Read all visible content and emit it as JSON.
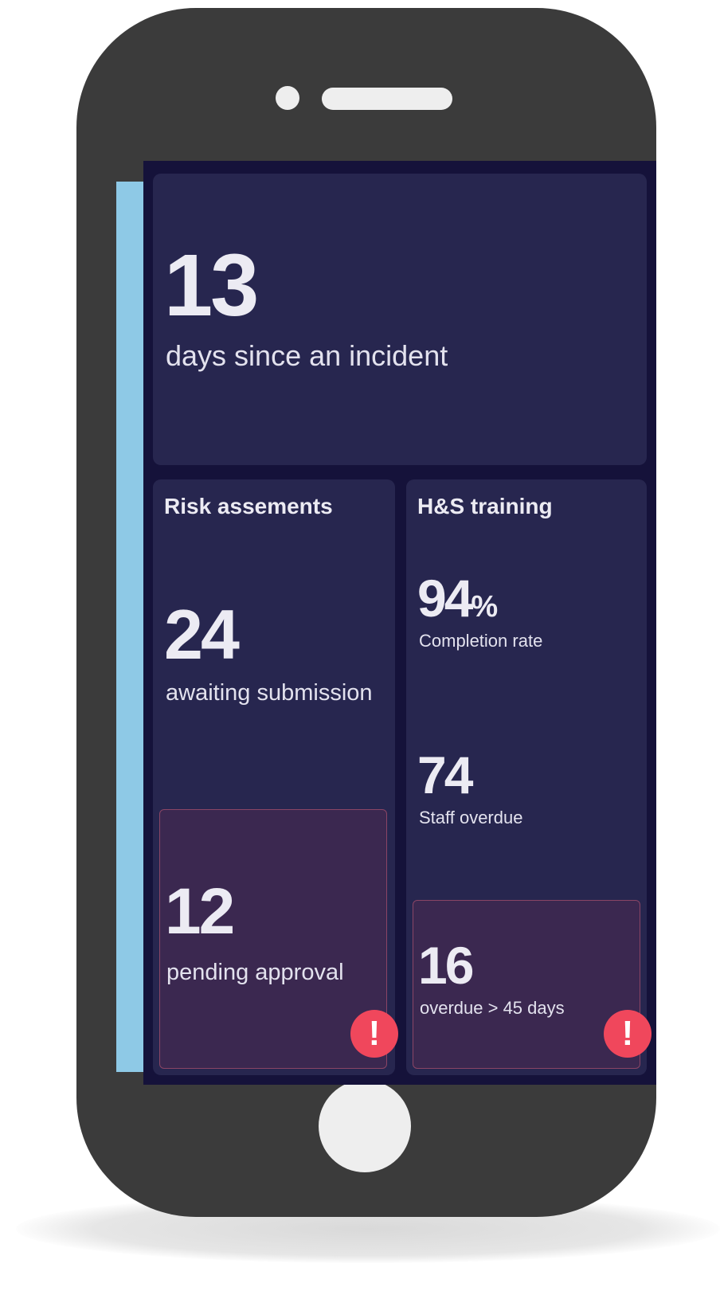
{
  "colors": {
    "phone_body": "#3b3b3b",
    "screen_background": "#15123a",
    "card_background": "#27264f",
    "alert_background": "#3b2850",
    "alert_badge": "#f0475c",
    "screen_edge": "#8ec9e6"
  },
  "incident": {
    "value": "13",
    "label": "days since an incident"
  },
  "risk_assessments": {
    "title": "Risk assements",
    "awaiting_value": "24",
    "awaiting_label": "awaiting submission",
    "pending_value": "12",
    "pending_label": "pending approval",
    "alert_icon": "exclamation-icon",
    "alert_glyph": "!"
  },
  "training": {
    "title": "H&S training",
    "completion_value": "94",
    "completion_unit": "%",
    "completion_label": "Completion rate",
    "staff_overdue_value": "74",
    "staff_overdue_label": "Staff overdue",
    "overdue_value": "16",
    "overdue_label": "overdue > 45 days",
    "alert_icon": "exclamation-icon",
    "alert_glyph": "!"
  }
}
